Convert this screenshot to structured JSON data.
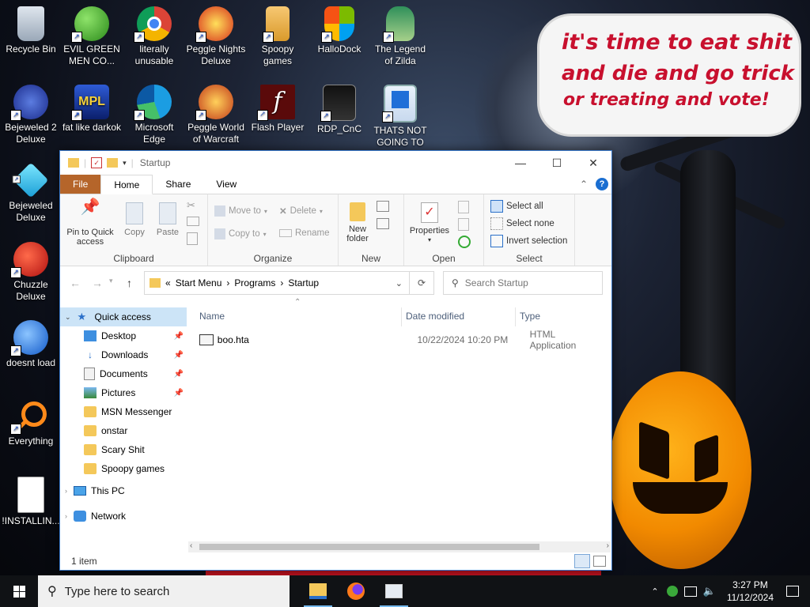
{
  "desktop": {
    "icons": [
      {
        "label": "Recycle Bin",
        "icon": "recycle-bin-icon"
      },
      {
        "label": "EVIL GREEN MEN CO...",
        "icon": "msn-people-icon"
      },
      {
        "label": "literally unusable",
        "icon": "chrome-icon"
      },
      {
        "label": "Peggle Nights Deluxe",
        "icon": "peggle-icon"
      },
      {
        "label": "Spoopy games",
        "icon": "folder-icon"
      },
      {
        "label": "HalloDock",
        "icon": "windows-logo-icon"
      },
      {
        "label": "The Legend of Zilda",
        "icon": "zilda-icon"
      },
      {
        "label": "Bejeweled 2 Deluxe",
        "icon": "bejeweled2-icon"
      },
      {
        "label": "fat like darkok",
        "icon": "mpl-icon"
      },
      {
        "label": "Microsoft Edge",
        "icon": "edge-icon"
      },
      {
        "label": "Peggle World of Warcraft",
        "icon": "peggle-wow-icon"
      },
      {
        "label": "Flash Player",
        "icon": "flash-icon"
      },
      {
        "label": "RDP_CnC",
        "icon": "rdp-icon"
      },
      {
        "label": "THATS NOT GOING TO F...",
        "icon": "monitor-icon"
      },
      {
        "label": "Bejeweled Deluxe",
        "icon": "gem-icon"
      },
      {
        "label": "Chuzzle Deluxe",
        "icon": "chuzzle-icon"
      },
      {
        "label": "doesnt load",
        "icon": "thunderbird-icon"
      },
      {
        "label": "Everything",
        "icon": "everything-icon"
      },
      {
        "label": "!INSTALLIN...",
        "icon": "document-icon"
      }
    ],
    "speech_bubble": {
      "line1": "it's time to eat shit",
      "line2": "and die and go trick",
      "line3": "or treating and vote!"
    }
  },
  "explorer": {
    "title": "Startup",
    "window_controls": {
      "minimize": "—",
      "maximize": "☐",
      "close": "✕"
    },
    "tabs": {
      "file": "File",
      "home": "Home",
      "share": "Share",
      "view": "View"
    },
    "ribbon": {
      "clipboard": {
        "label": "Clipboard",
        "pin": "Pin to Quick access",
        "copy": "Copy",
        "paste": "Paste"
      },
      "organize": {
        "label": "Organize",
        "move_to": "Move to",
        "copy_to": "Copy to",
        "delete": "Delete",
        "rename": "Rename"
      },
      "new": {
        "label": "New",
        "new_folder": "New folder"
      },
      "open": {
        "label": "Open",
        "properties": "Properties"
      },
      "select": {
        "label": "Select",
        "select_all": "Select all",
        "select_none": "Select none",
        "invert": "Invert selection"
      }
    },
    "address": {
      "prefix": "«",
      "crumbs": [
        "Start Menu",
        "Programs",
        "Startup"
      ],
      "separator": "›"
    },
    "search_placeholder": "Search Startup",
    "nav": [
      {
        "label": "Quick access",
        "pinned": false
      },
      {
        "label": "Desktop",
        "pinned": true
      },
      {
        "label": "Downloads",
        "pinned": true
      },
      {
        "label": "Documents",
        "pinned": true
      },
      {
        "label": "Pictures",
        "pinned": true
      },
      {
        "label": "MSN Messenger",
        "pinned": false
      },
      {
        "label": "onstar",
        "pinned": false
      },
      {
        "label": "Scary Shit",
        "pinned": false
      },
      {
        "label": "Spoopy games",
        "pinned": false
      },
      {
        "label": "This PC",
        "pinned": false
      },
      {
        "label": "Network",
        "pinned": false
      }
    ],
    "columns": {
      "name": "Name",
      "date": "Date modified",
      "type": "Type"
    },
    "files": [
      {
        "name": "boo.hta",
        "date": "10/22/2024 10:20 PM",
        "type": "HTML Application"
      }
    ],
    "status": "1 item"
  },
  "taskbar": {
    "search_placeholder": "Type here to search",
    "time": "3:27 PM",
    "date": "11/12/2024"
  }
}
